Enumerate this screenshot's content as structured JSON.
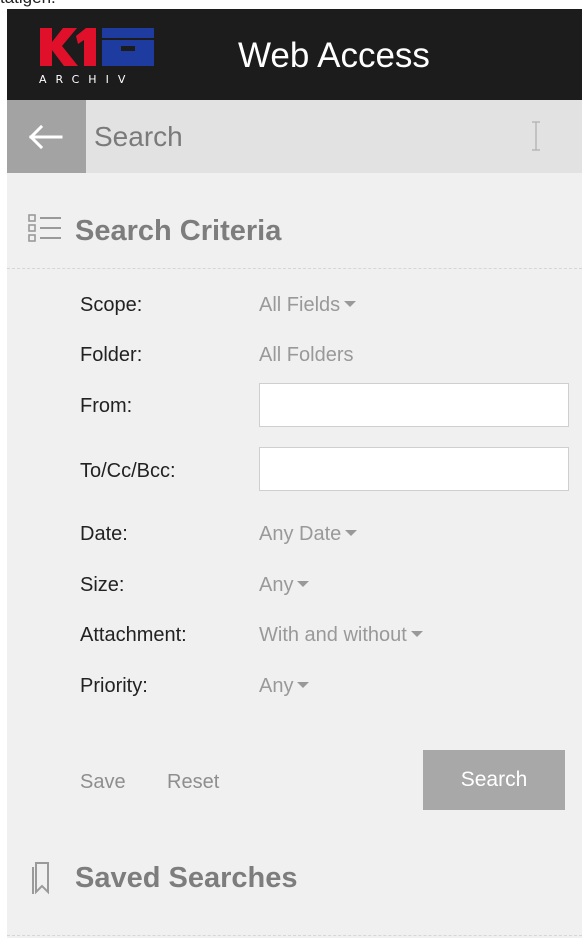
{
  "page_top_text": "tätigen.",
  "header": {
    "logo_mark": "K1",
    "logo_sub": "ARCHIV",
    "title": "Web Access"
  },
  "search_bar": {
    "back_icon": "arrow-left-icon",
    "placeholder": "Search",
    "value": ""
  },
  "search_criteria": {
    "icon": "list-icon",
    "title": "Search Criteria",
    "fields": {
      "scope": {
        "label": "Scope:",
        "value": "All Fields"
      },
      "folder": {
        "label": "Folder:",
        "value": "All Folders"
      },
      "from": {
        "label": "From:",
        "value": ""
      },
      "to": {
        "label": "To/Cc/Bcc:",
        "value": ""
      },
      "date": {
        "label": "Date:",
        "value": "Any Date"
      },
      "size": {
        "label": "Size:",
        "value": "Any"
      },
      "attachment": {
        "label": "Attachment:",
        "value": "With and without"
      },
      "priority": {
        "label": "Priority:",
        "value": "Any"
      }
    },
    "actions": {
      "save_label": "Save",
      "reset_label": "Reset",
      "search_label": "Search"
    }
  },
  "saved_searches": {
    "icon": "bookmark-icon",
    "title": "Saved Searches"
  },
  "colors": {
    "header_bg": "#1c1c1c",
    "logo_red": "#e0102a",
    "logo_blue": "#1e3ca0",
    "searchbar_bg": "#e2e2e2",
    "back_button_bg": "#a3a3a3",
    "panel_bg": "#f0f0f0",
    "search_button_bg": "#a8a8a8"
  }
}
